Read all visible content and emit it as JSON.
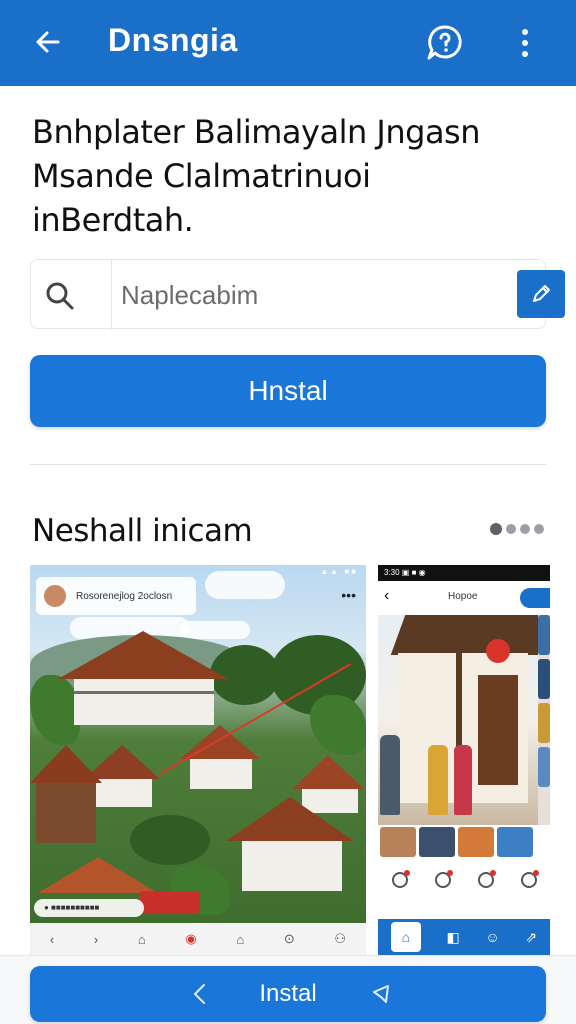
{
  "appbar": {
    "title": "Dnsngia",
    "back_icon": "arrow-left-icon",
    "help_icon": "help-chat-icon",
    "more_icon": "more-vertical-icon",
    "color": "#1a6fc9"
  },
  "heading": {
    "line1": "Bnhplater Balimayaln Jngasn",
    "line2": "Msande Clalmatrinuoi",
    "line3": "inBerdtah."
  },
  "search": {
    "placeholder": "Naplecabim",
    "value": "",
    "icon": "search-icon",
    "action_icon": "pen-icon"
  },
  "primary_button": {
    "label": "Hnstal",
    "color": "#1a77d9"
  },
  "section": {
    "title": "Neshall inicam",
    "pager_dots": 4,
    "active_dot": 1
  },
  "screenshot1": {
    "chip_label": "Rosorenejlog 2oclosn",
    "status_text": "▲▲ ■■",
    "more": "•••",
    "bottom_icons": [
      "‹",
      "›",
      "⌂",
      "◉",
      "⌂",
      "⊙",
      "⚇"
    ],
    "chip2_label": "●  ■■■■■■■■■■"
  },
  "screenshot2": {
    "status_text": "3:30 ▣ ■ ◉",
    "nav_title": "Hopoe",
    "back": "‹"
  },
  "bottom_button": {
    "label": "Instal",
    "left_icon": "chevron-left-icon",
    "right_icon": "share-icon"
  }
}
